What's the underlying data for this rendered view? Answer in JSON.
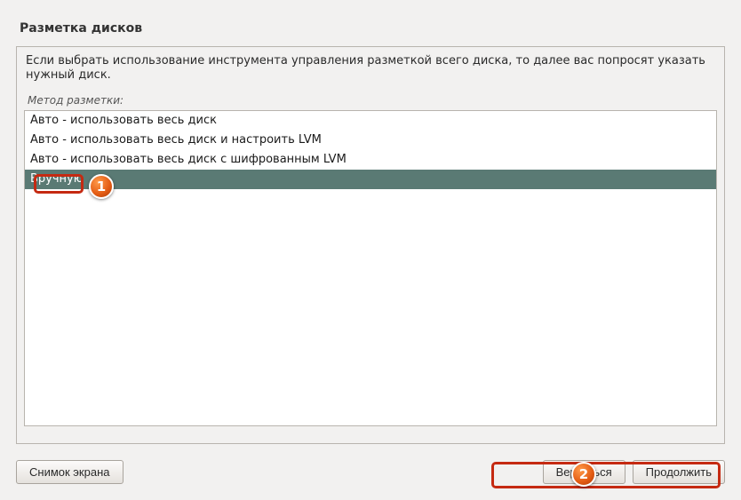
{
  "window": {
    "title": "Разметка дисков"
  },
  "panel": {
    "instruction": "Если выбрать использование инструмента управления разметкой всего диска, то далее вас попросят указать нужный диск.",
    "label": "Метод разметки:"
  },
  "methods": {
    "items": [
      {
        "label": "Авто - использовать весь диск",
        "selected": false
      },
      {
        "label": "Авто - использовать весь диск и настроить LVM",
        "selected": false
      },
      {
        "label": "Авто - использовать весь диск с шифрованным LVM",
        "selected": false
      },
      {
        "label": "Вручную",
        "selected": true
      }
    ]
  },
  "buttons": {
    "screenshot": "Снимок экрана",
    "back": "Вернуться",
    "continue": "Продолжить"
  },
  "annotations": {
    "badge1": "1",
    "badge2": "2"
  }
}
